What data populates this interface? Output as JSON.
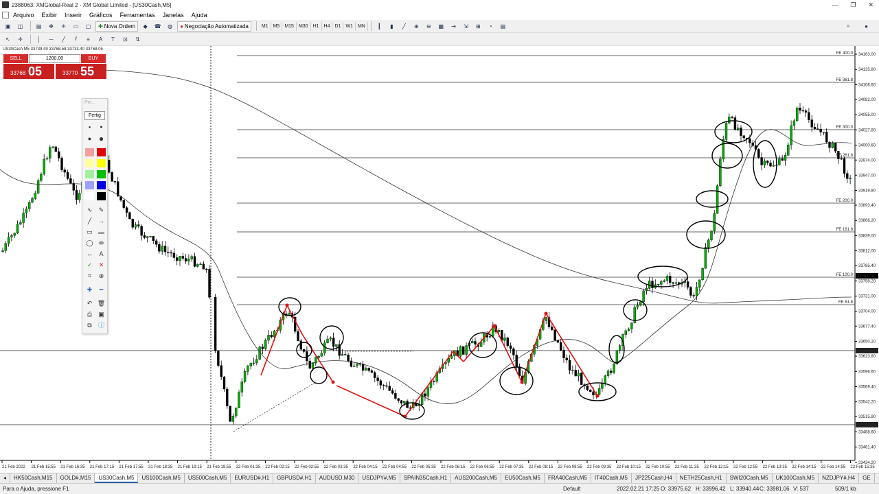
{
  "window": {
    "title": "2388063: XMGlobal-Real 2 - XM Global Limited - [US30Cash,M5]"
  },
  "menu": {
    "items": [
      "Arquivo",
      "Exibir",
      "Inserir",
      "Gráficos",
      "Ferramentas",
      "Janelas",
      "Ajuda"
    ]
  },
  "toolbar": {
    "new_order": "Nova Ordem",
    "auto_trading": "Negociação Automatizada",
    "timeframes": [
      "M1",
      "M5",
      "M15",
      "M30",
      "H1",
      "H4",
      "D1",
      "W1",
      "MN"
    ]
  },
  "chart": {
    "symbol_info": "US30Cash,M5  33739.49 33768.58 33733.40 33768.05",
    "sell_label": "SELL",
    "buy_label": "BUY",
    "lot": "1200.00",
    "sell_price_small": "33768",
    "sell_price_big": "05",
    "buy_price_small": "33770",
    "buy_price_big": "55",
    "current_price": "33768.05",
    "price_ticks": [
      "34163.00",
      "34135.80",
      "34108.60",
      "34082.00",
      "34055.00",
      "34027.80",
      "34000.60",
      "33974.00",
      "33947.00",
      "33919.80",
      "33893.40",
      "33866.20",
      "33839.00",
      "33812.00",
      "33785.40",
      "33758.20",
      "33731.00",
      "33704.00",
      "33677.40",
      "33650.20",
      "33623.80",
      "33596.60",
      "33569.40",
      "33542.20",
      "33515.80",
      "33488.60",
      "33461.40",
      "33434.20"
    ],
    "time_ticks": [
      "21 Feb 2022",
      "21 Feb 15:55",
      "21 Feb 16:35",
      "21 Feb 17:15",
      "21 Feb 17:55",
      "21 Feb 18:35",
      "21 Feb 19:15",
      "21 Feb 19:55",
      "22 Feb 01:35",
      "22 Feb 02:15",
      "22 Feb 02:55",
      "22 Feb 03:35",
      "22 Feb 04:15",
      "22 Feb 04:55",
      "22 Feb 05:35",
      "22 Feb 06:15",
      "22 Feb 06:55",
      "22 Feb 07:35",
      "22 Feb 08:15",
      "22 Feb 08:55",
      "22 Feb 09:35",
      "22 Feb 10:15",
      "22 Feb 10:55",
      "22 Feb 11:35",
      "22 Feb 12:15",
      "22 Feb 12:55",
      "22 Feb 13:35",
      "22 Feb 14:15",
      "22 Feb 14:55",
      "22 Feb 15:35"
    ],
    "fibo_labels": [
      "FE 400.0",
      "FE 361.8",
      "FE 300.0",
      "FE 261.8",
      "FE 200.0",
      "FE 161.8",
      "FE 100.0",
      "FE 61.8"
    ],
    "hline_labels": [
      "33634.48",
      "33502.56"
    ]
  },
  "draw_panel": {
    "title": "Poi...",
    "done_label": "Fertig"
  },
  "tabs": [
    "HK50Cash,M15",
    "GOLD#,M15",
    "US30Cash,M5",
    "US100Cash,M5",
    "US500Cash,M5",
    "EURUSD#,H1",
    "GBPUSD#,H1",
    "AUDUSD,M30",
    "USDJPY#,M5",
    "SPAIN35Cash,H1",
    "AUS200Cash,M5",
    "EU50Cash,M5",
    "FRA40Cash,M5",
    "IT40Cash,M5",
    "JP225Cash,H4",
    "NETH25Cash,H1",
    "SWI20Cash,M5",
    "UK100Cash,M5",
    "NZDJPY#,H4",
    "GE"
  ],
  "active_tab": "US30Cash,M5",
  "status": {
    "help": "Para o Ajuda, pressione F1",
    "profile": "Default",
    "datetime": "2022.02.21 17:25",
    "open": "O: 33975.62",
    "high": "H: 33996.42",
    "low": "L: 33940.44",
    "close": "C: 33981.06",
    "volume": "V: 537",
    "traffic": "509/1 kb"
  },
  "colors": {
    "sell": "#d62b2b",
    "annotation": "#e01010",
    "fibo": "#333333"
  }
}
